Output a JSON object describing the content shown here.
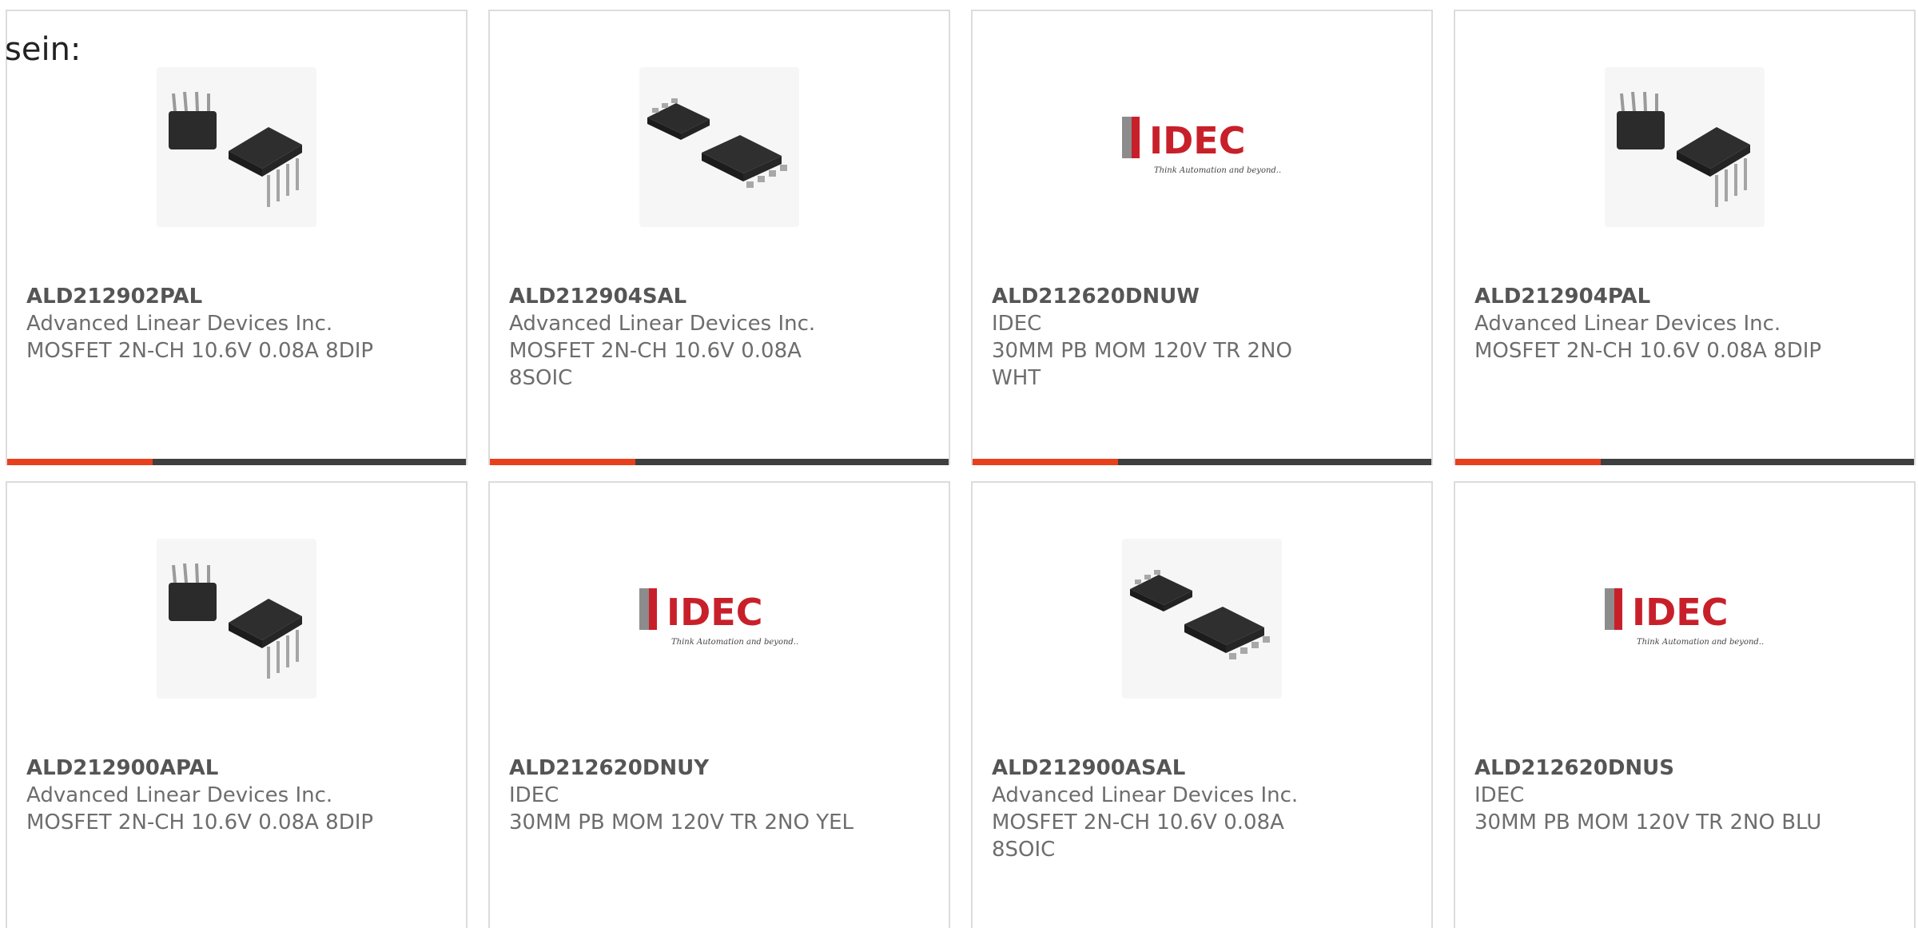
{
  "intro": "sein:",
  "colors": {
    "accent": "#e8401c",
    "bar": "#3f3f3f",
    "border": "#dcdcdc",
    "idec_red": "#c8202a"
  },
  "products": [
    {
      "part_number": "ALD212902PAL",
      "manufacturer": "Advanced Linear Devices Inc.",
      "description": "MOSFET 2N-CH 10.6V 0.08A 8DIP",
      "image": "dip-8-chip-image"
    },
    {
      "part_number": "ALD212904SAL",
      "manufacturer": "Advanced Linear Devices Inc.",
      "description": "MOSFET 2N-CH 10.6V 0.08A 8SOIC",
      "image": "soic-8-chip-image"
    },
    {
      "part_number": "ALD212620DNUW",
      "manufacturer": "IDEC",
      "description": "30MM PB MOM 120V TR 2NO WHT",
      "image": "idec-logo"
    },
    {
      "part_number": "ALD212904PAL",
      "manufacturer": "Advanced Linear Devices Inc.",
      "description": "MOSFET 2N-CH 10.6V 0.08A 8DIP",
      "image": "dip-8-chip-image"
    },
    {
      "part_number": "ALD212900APAL",
      "manufacturer": "Advanced Linear Devices Inc.",
      "description": "MOSFET 2N-CH 10.6V 0.08A 8DIP",
      "image": "dip-8-chip-image"
    },
    {
      "part_number": "ALD212620DNUY",
      "manufacturer": "IDEC",
      "description": "30MM PB MOM 120V TR 2NO YEL",
      "image": "idec-logo"
    },
    {
      "part_number": "ALD212900ASAL",
      "manufacturer": "Advanced Linear Devices Inc.",
      "description": "MOSFET 2N-CH 10.6V 0.08A 8SOIC",
      "image": "soic-8-chip-image"
    },
    {
      "part_number": "ALD212620DNUS",
      "manufacturer": "IDEC",
      "description": "30MM PB MOM 120V TR 2NO BLU",
      "image": "idec-logo"
    }
  ],
  "logo": {
    "brand": "IDEC",
    "tagline": "Think Automation and beyond..."
  }
}
